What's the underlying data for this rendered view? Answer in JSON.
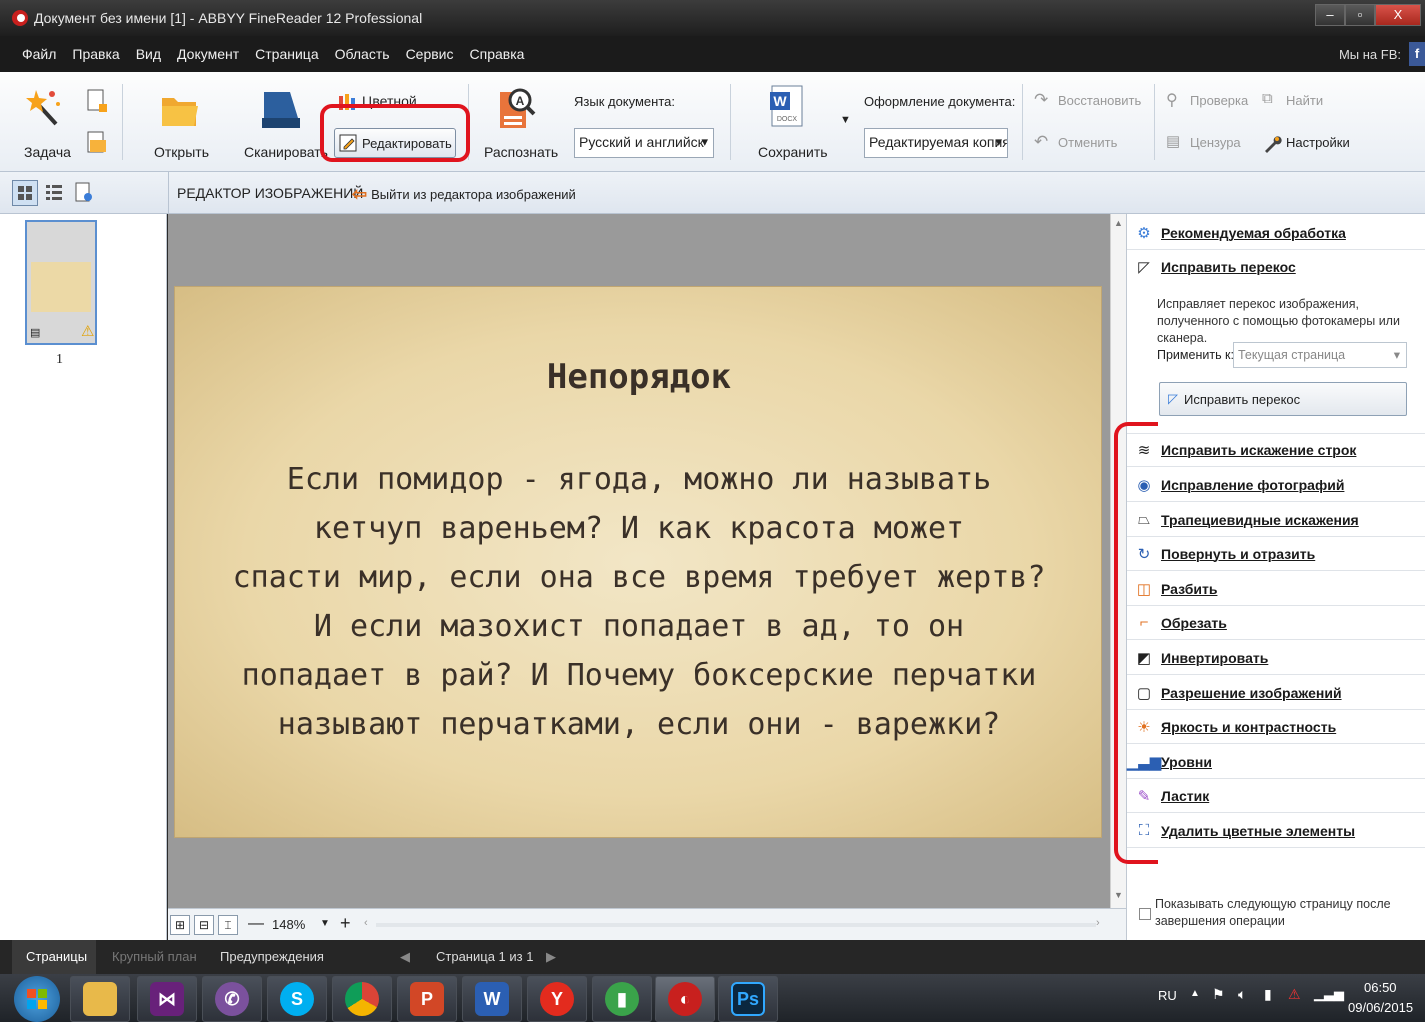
{
  "window": {
    "title": "Документ без имени [1] - ABBYY FineReader 12 Professional",
    "controls": {
      "minimize": "–",
      "maximize": "▫",
      "close": "X"
    }
  },
  "menu": {
    "items": [
      "Файл",
      "Правка",
      "Вид",
      "Документ",
      "Страница",
      "Область",
      "Сервис",
      "Справка"
    ],
    "fb_label": "Мы на FB:",
    "fb_icon": "f"
  },
  "toolbar": {
    "task": "Задача",
    "open": "Открыть",
    "scan": "Сканировать",
    "color": "Цветной",
    "edit": "Редактировать",
    "recognize": "Распознать",
    "lang_label": "Язык документа:",
    "lang_value": "Русский и английск",
    "save": "Сохранить",
    "format_label": "Оформление документа:",
    "format_value": "Редактируемая копия",
    "restore": "Восстановить",
    "undo": "Отменить",
    "check": "Проверка",
    "find": "Найти",
    "censor": "Цензура",
    "settings": "Настройки"
  },
  "editor": {
    "title": "РЕДАКТОР ИЗОБРАЖЕНИЙ",
    "exit": "Выйти из редактора изображений"
  },
  "thumbnail": {
    "page_number": "1"
  },
  "page": {
    "title": "Непорядок",
    "lines": [
      "Если помидор - ягода, можно ли называть",
      "кетчуп вареньем? И как красота может",
      "спасти мир, если она все время требует жертв?",
      "И если мазохист попадает в ад, то он",
      "попадает в рай? И Почему боксерские перчатки",
      "называют перчатками, если они - варежки?"
    ]
  },
  "zoom": {
    "value": "148%",
    "minus": "—",
    "plus": "+"
  },
  "right_panel": {
    "recommended": "Рекомендуемая обработка",
    "deskew": "Исправить перекос",
    "deskew_desc": "Исправляет перекос изображения, полученного с помощью фотокамеры или сканера.",
    "apply_label": "Применить к:",
    "apply_value": "Текущая страница",
    "deskew_button": "Исправить перекос",
    "tools": [
      "Исправить искажение строк",
      "Исправление фотографий",
      "Трапециевидные искажения",
      "Повернуть и отразить",
      "Разбить",
      "Обрезать",
      "Инвертировать",
      "Разрешение изображений",
      "Яркость и контрастность",
      "Уровни",
      "Ластик",
      "Удалить цветные элементы"
    ],
    "show_next": "Показывать следующую страницу после завершения операции"
  },
  "statusbar": {
    "pages": "Страницы",
    "closeup": "Крупный план",
    "warnings": "Предупреждения",
    "page_info": "Страница 1 из 1"
  },
  "taskbar": {
    "apps": [
      "start-orb",
      "explorer",
      "visual-studio",
      "viber",
      "skype",
      "chrome",
      "powerpoint",
      "word",
      "yandex",
      "charts",
      "finereader",
      "photoshop"
    ],
    "glyphs": [
      "",
      "",
      "",
      "",
      "S",
      "",
      "P",
      "W",
      "Y",
      "",
      "",
      "Ps"
    ],
    "lang": "RU",
    "time": "06:50",
    "date": "09/06/2015"
  },
  "colors": {
    "annotation_red": "#e0141e",
    "page_paper": "#ead7a8",
    "title_bar": "#1e1e1e"
  }
}
